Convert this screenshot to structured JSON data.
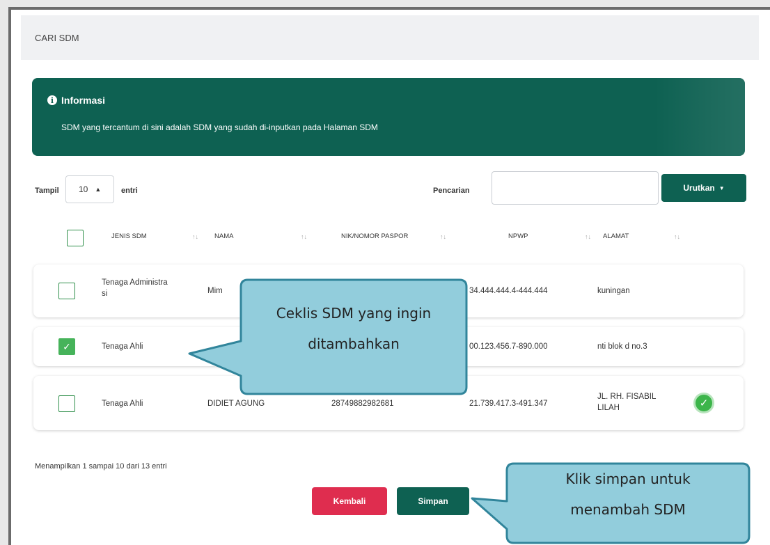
{
  "search_header": {
    "title": "CARI SDM"
  },
  "info": {
    "title": "Informasi",
    "text": "SDM yang tercantum di sini adalah SDM yang sudah di-inputkan pada Halaman SDM"
  },
  "controls": {
    "show_label": "Tampil",
    "show_value": "10",
    "entries_label": "entri",
    "search_label": "Pencarian",
    "search_value": "",
    "sort_label": "Urutkan"
  },
  "table": {
    "headers": [
      "JENIS SDM",
      "NAMA",
      "NIK/NOMOR PASPOR",
      "NPWP",
      "ALAMAT"
    ],
    "rows": [
      {
        "jenis_l1": "Tenaga Administra",
        "jenis_l2": "si",
        "nama": "Mim",
        "nik": "",
        "npwp": "34.444.444.4-444.444",
        "alamat_l1": "kuningan",
        "alamat_l2": "",
        "checked": false
      },
      {
        "jenis_l1": "Tenaga Ahli",
        "jenis_l2": "",
        "nama": "",
        "nik": "",
        "npwp": "00.123.456.7-890.000",
        "alamat_l1": "nti blok d no.3",
        "alamat_l2": "",
        "checked": true
      },
      {
        "jenis_l1": "Tenaga Ahli",
        "jenis_l2": "",
        "nama": "DIDIET AGUNG",
        "nik": "28749882982681",
        "npwp": "21.739.417.3-491.347",
        "alamat_l1": "JL. RH. FISABIL",
        "alamat_l2": "LILAH",
        "checked": false
      }
    ]
  },
  "footer": {
    "summary": "Menampilkan 1 sampai 10 dari 13 entri"
  },
  "buttons": {
    "back": "Kembali",
    "save": "Simpan"
  },
  "callouts": {
    "select": {
      "line1": "Ceklis SDM yang ingin",
      "line2": "ditambahkan"
    },
    "save": {
      "line1": "Klik simpan untuk",
      "line2": "menambah SDM"
    }
  },
  "colors": {
    "primary": "#0e6152",
    "danger": "#df2d4f",
    "check": "#46b35a",
    "callout_fill": "#92cddc",
    "callout_stroke": "#31859b"
  }
}
